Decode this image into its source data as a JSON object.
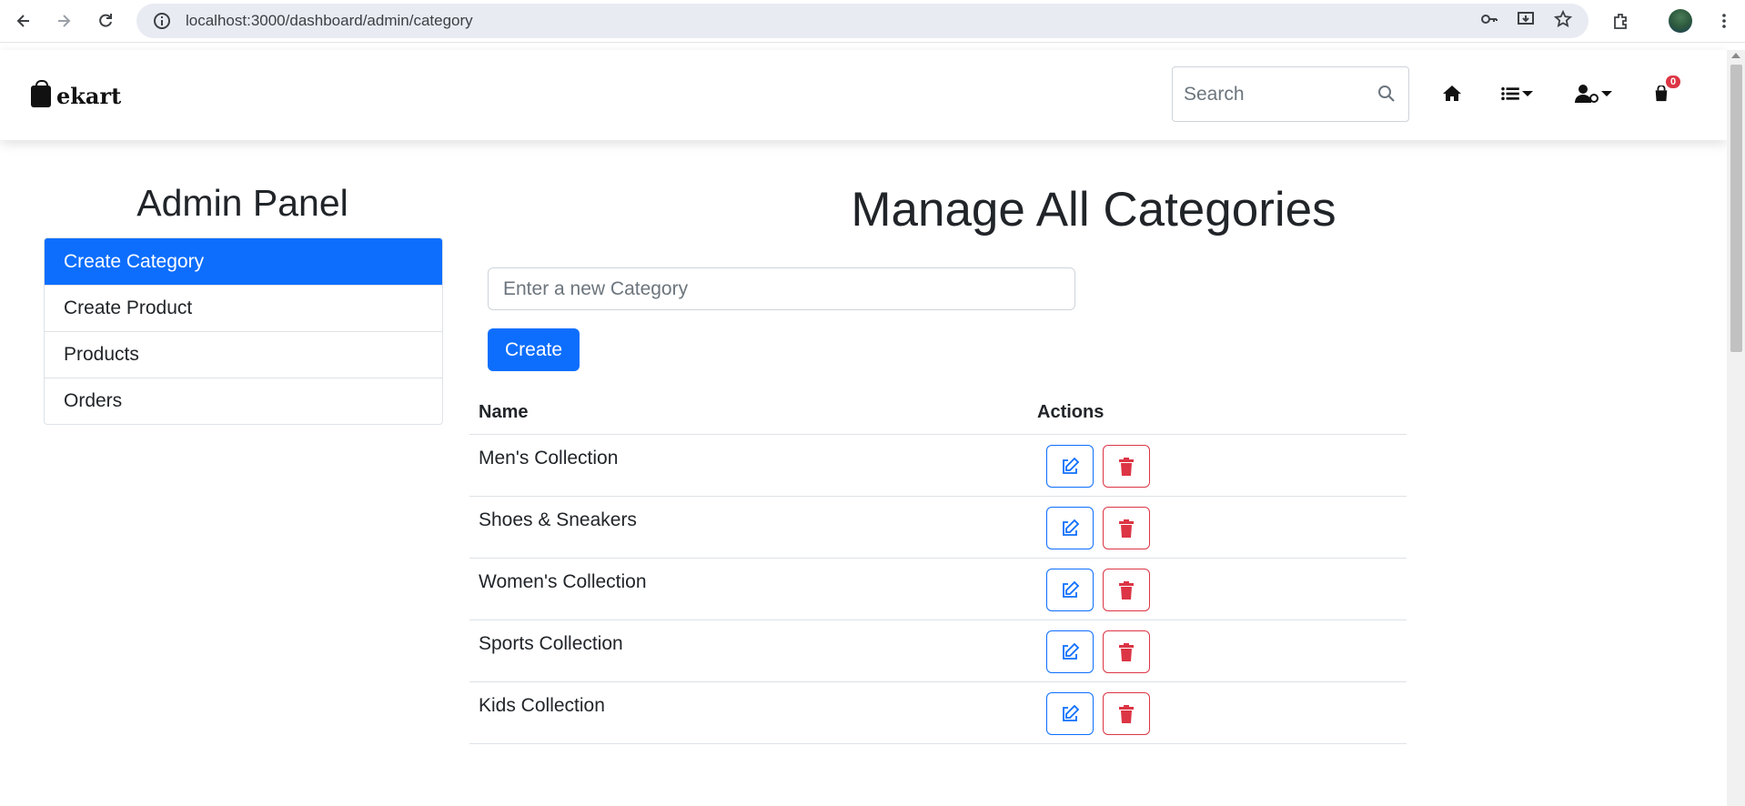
{
  "browser": {
    "url": "localhost:3000/dashboard/admin/category"
  },
  "navbar": {
    "brand": "ekart",
    "search_placeholder": "Search",
    "cart_count": "0"
  },
  "sidebar": {
    "title": "Admin Panel",
    "items": [
      {
        "label": "Create Category",
        "active": true
      },
      {
        "label": "Create Product",
        "active": false
      },
      {
        "label": "Products",
        "active": false
      },
      {
        "label": "Orders",
        "active": false
      }
    ]
  },
  "main": {
    "title": "Manage All Categories",
    "input_placeholder": "Enter a new Category",
    "create_label": "Create",
    "table": {
      "headers": [
        "Name",
        "Actions"
      ],
      "rows": [
        {
          "name": "Men's Collection"
        },
        {
          "name": "Shoes & Sneakers"
        },
        {
          "name": "Women's Collection"
        },
        {
          "name": "Sports Collection"
        },
        {
          "name": "Kids Collection"
        }
      ]
    }
  },
  "colors": {
    "primary": "#0d6efd",
    "danger": "#dc3545"
  }
}
